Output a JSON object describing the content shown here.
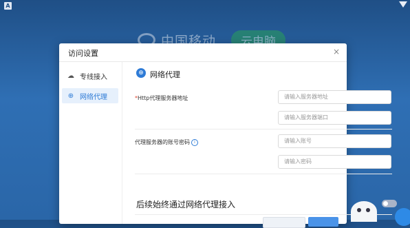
{
  "desktop": {
    "corner_glyph": "A",
    "brand_logo_text": "中国移动",
    "brand_badge_text": "云电脑"
  },
  "dialog": {
    "title": "访问设置",
    "close_glyph": "×",
    "sidebar": {
      "items": [
        {
          "label": "专线接入",
          "icon": "cloud-link-icon",
          "active": false
        },
        {
          "label": "网络代理",
          "icon": "globe-icon",
          "active": true
        }
      ]
    },
    "section": {
      "title": "网络代理",
      "proxy_address_label": "Http代理服务器地址",
      "required_mark": "*",
      "address_placeholder": "请输入服务器地址",
      "port_placeholder": "请输入服务器端口",
      "account_label": "代理服务器的账号密码",
      "account_placeholder": "请输入账号",
      "password_placeholder": "请输入密码",
      "always_proxy_label": "后续始终通过网络代理接入",
      "always_proxy_enabled": false
    }
  },
  "colors": {
    "accent": "#2e7bd6",
    "active_bg": "#e6f0fc",
    "toggle_off": "#a9b4c8"
  }
}
